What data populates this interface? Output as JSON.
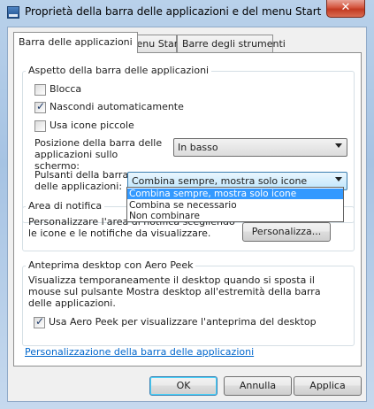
{
  "window": {
    "title": "Proprietà della barra delle applicazioni e del menu Start",
    "close_glyph": "✕"
  },
  "tabs": [
    {
      "label": "Barra delle applicazioni",
      "selected": true
    },
    {
      "label": "Menu Start",
      "selected": false
    },
    {
      "label": "Barre degli strumenti",
      "selected": false
    }
  ],
  "appearance": {
    "legend": "Aspetto della barra delle applicazioni",
    "lock": {
      "label": "Blocca",
      "checked": false
    },
    "autohide": {
      "label": "Nascondi automaticamente",
      "checked": true
    },
    "small_icons": {
      "label": "Usa icone piccole",
      "checked": false
    },
    "position_label": "Posizione della barra delle applicazioni sullo schermo:",
    "position_value": "In basso",
    "buttons_label": "Pulsanti della barra delle applicazioni:",
    "buttons_value": "Combina sempre, mostra solo icone",
    "buttons_options": [
      "Combina sempre, mostra solo icone",
      "Combina se necessario",
      "Non combinare"
    ]
  },
  "notification": {
    "legend": "Area di notifica",
    "description": "Personalizzare l'area di notifica scegliendo le icone e le notifiche da visualizzare.",
    "customize_button": "Personalizza..."
  },
  "aero_peek": {
    "legend": "Anteprima desktop con Aero Peek",
    "description": "Visualizza temporaneamente il desktop quando si sposta il mouse sul pulsante Mostra desktop all'estremità della barra delle applicazioni.",
    "use_peek": {
      "label": "Usa Aero Peek per visualizzare l'anteprima del desktop",
      "checked": true
    }
  },
  "customize_link": "Personalizzazione della barra delle applicazioni",
  "footer": {
    "ok": "OK",
    "cancel": "Annulla",
    "apply": "Applica"
  },
  "check_glyph": "✓",
  "colors": {
    "accent": "#3399ff",
    "link": "#0066cc"
  }
}
